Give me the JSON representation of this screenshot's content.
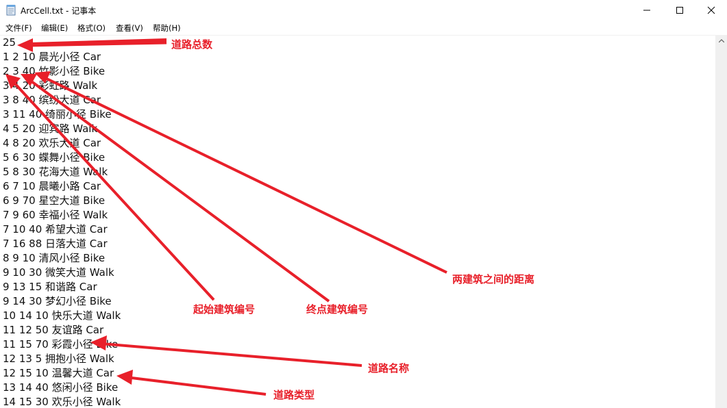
{
  "window": {
    "title": "ArcCell.txt - 记事本"
  },
  "menu": {
    "file": "文件(F)",
    "edit": "编辑(E)",
    "format": "格式(O)",
    "view": "查看(V)",
    "help": "帮助(H)"
  },
  "lines": [
    "25",
    "1 2 10 晨光小径 Car",
    "2 3 40 竹影小径 Bike",
    "3 4 20 彩虹路 Walk",
    "3 8 40 缤纷大道 Car",
    "3 11 40 绮丽小径 Bike",
    "4 5 20 迎宾路 Walk",
    "4 8 20 欢乐大道 Car",
    "5 6 30 蝶舞小径 Bike",
    "5 8 30 花海大道 Walk",
    "6 7 10 晨曦小路 Car",
    "6 9 70 星空大道 Bike",
    "7 9 60 幸福小径 Walk",
    "7 10 40 希望大道 Car",
    "7 16 88 日落大道 Car",
    "8 9 10 清风小径 Bike",
    "9 10 30 微笑大道 Walk",
    "9 13 15 和谐路 Car",
    "9 14 30 梦幻小径 Bike",
    "10 14 10 快乐大道 Walk",
    "11 12 50 友谊路 Car",
    "11 15 70 彩霞小径 Bike",
    "12 13 5 拥抱小径 Walk",
    "12 15 10 温馨大道 Car",
    "13 14 40 悠闲小径 Bike",
    "14 15 30 欢乐小径 Walk"
  ],
  "annotations": {
    "total_roads": "道路总数",
    "distance": "两建筑之间的距离",
    "start_building": "起始建筑编号",
    "end_building": "终点建筑编号",
    "road_name": "道路名称",
    "road_type": "道路类型"
  },
  "colors": {
    "annotation": "#e8202a",
    "text": "#111111"
  }
}
